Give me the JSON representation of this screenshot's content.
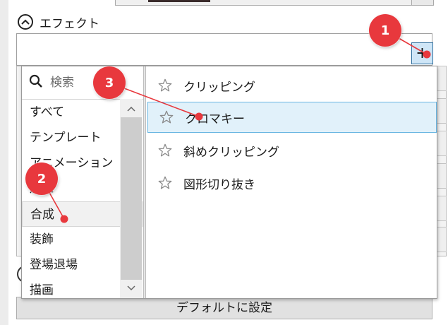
{
  "effect_section": {
    "title": "エフェクト"
  },
  "add_button": {
    "label": "+"
  },
  "search": {
    "placeholder": "検索"
  },
  "categories": [
    {
      "label": "すべて"
    },
    {
      "label": "テンプレート"
    },
    {
      "label": "アニメーション"
    },
    {
      "label": "加工"
    },
    {
      "label": "合成"
    },
    {
      "label": "装飾"
    },
    {
      "label": "登場退場"
    },
    {
      "label": "描画"
    }
  ],
  "selected_category": "合成",
  "effects": [
    {
      "label": "クリッピング"
    },
    {
      "label": "クロマキー"
    },
    {
      "label": "斜めクリッピング"
    },
    {
      "label": "図形切り抜き"
    }
  ],
  "selected_effect": "クロマキー",
  "bottom_button": {
    "label": "デフォルトに設定"
  },
  "annotations": [
    {
      "number": "1"
    },
    {
      "number": "2"
    },
    {
      "number": "3"
    }
  ],
  "colors": {
    "annotation": "#e8383d",
    "selection_border": "#6ab6e2",
    "selection_bg": "#e1f1fa",
    "add_button_bg": "#cfe6f7"
  }
}
